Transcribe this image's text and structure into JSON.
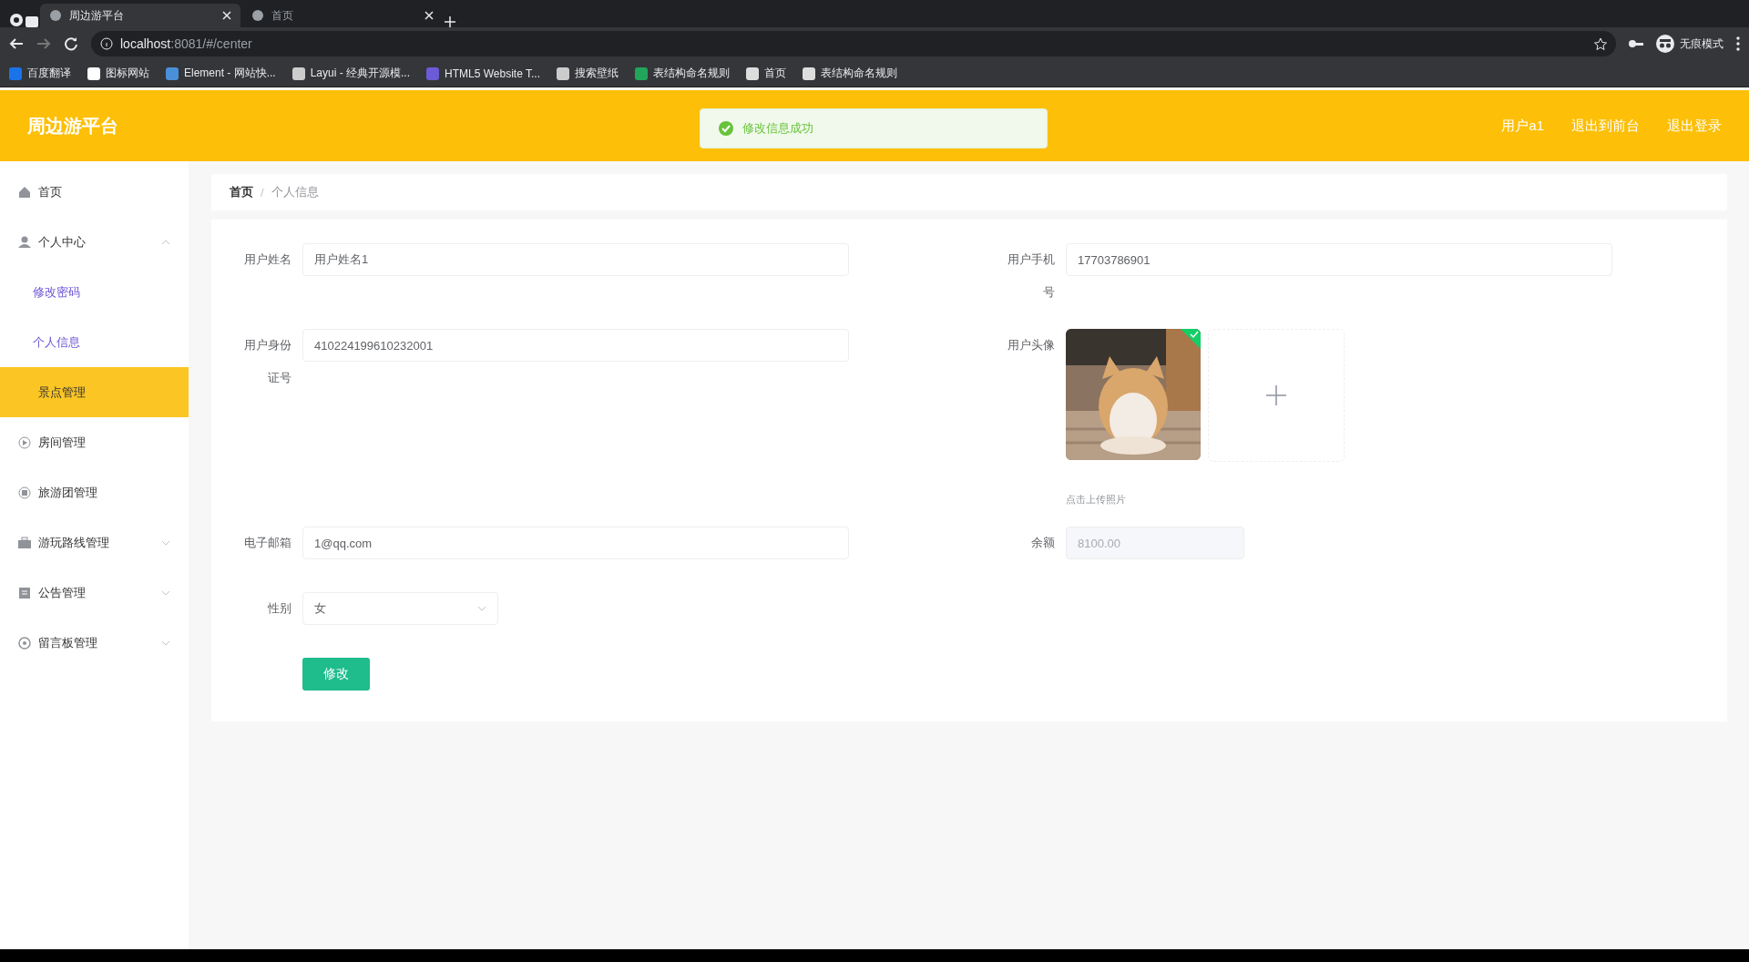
{
  "browser": {
    "tabs": [
      {
        "title": "周边游平台",
        "selected": true
      },
      {
        "title": "首页",
        "selected": false
      }
    ],
    "url_host": "localhost",
    "url_rest": ":8081/#/center",
    "profile": "无痕模式",
    "bookmarks": [
      "百度翻译",
      "图标网站",
      "Element - 网站快...",
      "Layui - 经典开源模...",
      "HTML5 Website T...",
      "搜索壁纸",
      "表结构命名规则",
      "首页",
      "表结构命名规则"
    ]
  },
  "header": {
    "title": "周边游平台",
    "toast": "修改信息成功",
    "links": [
      "用户a1",
      "退出到前台",
      "退出登录"
    ]
  },
  "sidebar": {
    "items": [
      {
        "label": "首页",
        "selected": false
      },
      {
        "label": "个人中心",
        "selected": false,
        "expanded": true,
        "children": [
          {
            "label": "修改密码",
            "selected": false
          },
          {
            "label": "个人信息",
            "selected": false
          }
        ]
      },
      {
        "label": "景点管理",
        "selected": true
      },
      {
        "label": "房间管理",
        "selected": false
      },
      {
        "label": "旅游团管理",
        "selected": false
      },
      {
        "label": "游玩路线管理",
        "selected": false,
        "expanded": false
      },
      {
        "label": "公告管理",
        "selected": false,
        "expanded": false
      },
      {
        "label": "留言板管理",
        "selected": false,
        "expanded": false
      }
    ]
  },
  "breadcrumb": {
    "items": [
      "首页",
      "个人信息"
    ],
    "separator": "/"
  },
  "form": {
    "rows": [
      {
        "cells": [
          {
            "kind": "input",
            "label": "用户姓名",
            "value": "用户姓名1"
          },
          {
            "kind": "input",
            "label": "用户手机号",
            "value": "17703786901"
          }
        ]
      },
      {
        "cells": [
          {
            "kind": "input",
            "label": "用户身份证号",
            "value": "410224199610232001"
          },
          {
            "kind": "upload",
            "label": "用户头像",
            "uploaded": true,
            "hint": "点击上传照片"
          }
        ]
      },
      {
        "cells": [
          {
            "kind": "input",
            "label": "电子邮箱",
            "value": "1@qq.com"
          },
          {
            "kind": "input",
            "label": "余额",
            "value": "8100.00",
            "disabled": true
          }
        ]
      },
      {
        "cells": [
          {
            "kind": "select",
            "label": "性别",
            "value": "女"
          }
        ]
      }
    ],
    "submit": "修改"
  }
}
